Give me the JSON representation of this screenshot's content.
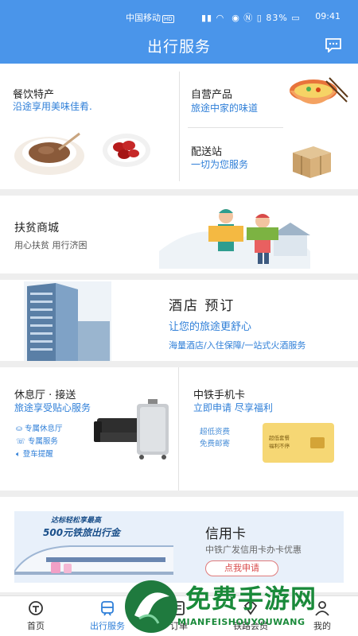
{
  "status_bar": {
    "carrier": "中国移动",
    "hd": "HD",
    "battery": "83%",
    "time": "09:41"
  },
  "header": {
    "title": "出行服务"
  },
  "catering": {
    "title": "餐饮特产",
    "subtitle": "沿途享用美味佳肴."
  },
  "own_products": {
    "title": "自营产品",
    "subtitle": "旅途中家的味道"
  },
  "delivery": {
    "title": "配送站",
    "subtitle": "一切为您服务"
  },
  "poverty_mall": {
    "title": "扶贫商城",
    "subtitle": "用心扶贫 用行济困"
  },
  "hotel": {
    "title": "酒店  预订",
    "subtitle": "让您的旅途更舒心",
    "desc": "海量酒店/入住保障/一站式火酒服务"
  },
  "lounge": {
    "title": "休息厅 · 接送",
    "subtitle": "旅途享受贴心服务",
    "features": [
      "专属休息厅",
      "专属服务",
      "登车提醒"
    ]
  },
  "sim_card": {
    "title": "中铁手机卡",
    "subtitle": "立即申请  尽享福利",
    "features": [
      "超低资费",
      "免费邮寄"
    ],
    "card_text1": "超低套餐",
    "card_text2": "福利不停"
  },
  "credit_card": {
    "banner_line1": "达标轻松享最高",
    "banner_line2": "500元铁旅出行金",
    "title": "信用卡",
    "subtitle": "中铁广发信用卡办卡优惠",
    "button": "点我申请"
  },
  "nav": {
    "items": [
      {
        "label": "首页"
      },
      {
        "label": "出行服务"
      },
      {
        "label": "订单"
      },
      {
        "label": "铁路会员"
      },
      {
        "label": "我的"
      }
    ]
  },
  "watermark": {
    "text": "免费手游网",
    "sub": "MIANFEISHOUYOUWANG"
  },
  "colors": {
    "primary": "#4a95ea",
    "accent_text": "#2f7fd8",
    "apply_red": "#d94a4a",
    "watermark_green": "#1a8a3a"
  }
}
